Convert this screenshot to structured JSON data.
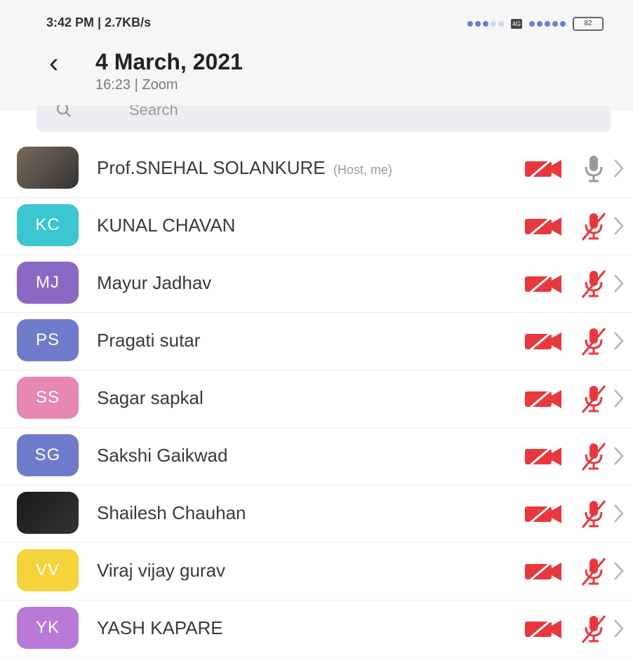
{
  "status_bar": {
    "time_speed": "3:42 PM | 2.7KB/s",
    "sim_label": "4G",
    "battery": "82"
  },
  "header": {
    "title": "4 March, 2021",
    "subtitle": "16:23 | Zoom"
  },
  "search": {
    "placeholder": "Search"
  },
  "colors": {
    "muted_red": "#e8383d",
    "mic_gray": "#9a9a9a"
  },
  "participants": [
    {
      "initials": "",
      "name": "Prof.SNEHAL SOLANKURE",
      "tag": "(Host, me)",
      "avatar_color": "#7a6a5a",
      "avatar_type": "photo",
      "mic_muted": false
    },
    {
      "initials": "KC",
      "name": "KUNAL CHAVAN",
      "tag": "",
      "avatar_color": "#3cc6cf",
      "avatar_type": "initials",
      "mic_muted": true
    },
    {
      "initials": "MJ",
      "name": "Mayur Jadhav",
      "tag": "",
      "avatar_color": "#8a68c4",
      "avatar_type": "initials",
      "mic_muted": true
    },
    {
      "initials": "PS",
      "name": "Pragati sutar",
      "tag": "",
      "avatar_color": "#6f7bcb",
      "avatar_type": "initials",
      "mic_muted": true
    },
    {
      "initials": "SS",
      "name": "Sagar sapkal",
      "tag": "",
      "avatar_color": "#e687b4",
      "avatar_type": "initials",
      "mic_muted": true
    },
    {
      "initials": "SG",
      "name": "Sakshi Gaikwad",
      "tag": "",
      "avatar_color": "#6f7bcb",
      "avatar_type": "initials",
      "mic_muted": true
    },
    {
      "initials": "",
      "name": "Shailesh Chauhan",
      "tag": "",
      "avatar_color": "#1a1a1a",
      "avatar_type": "photo",
      "mic_muted": true
    },
    {
      "initials": "VV",
      "name": "Viraj vijay gurav",
      "tag": "",
      "avatar_color": "#f5d33a",
      "avatar_type": "initials",
      "mic_muted": true
    },
    {
      "initials": "YK",
      "name": "YASH KAPARE",
      "tag": "",
      "avatar_color": "#b87ad6",
      "avatar_type": "initials",
      "mic_muted": true
    }
  ]
}
